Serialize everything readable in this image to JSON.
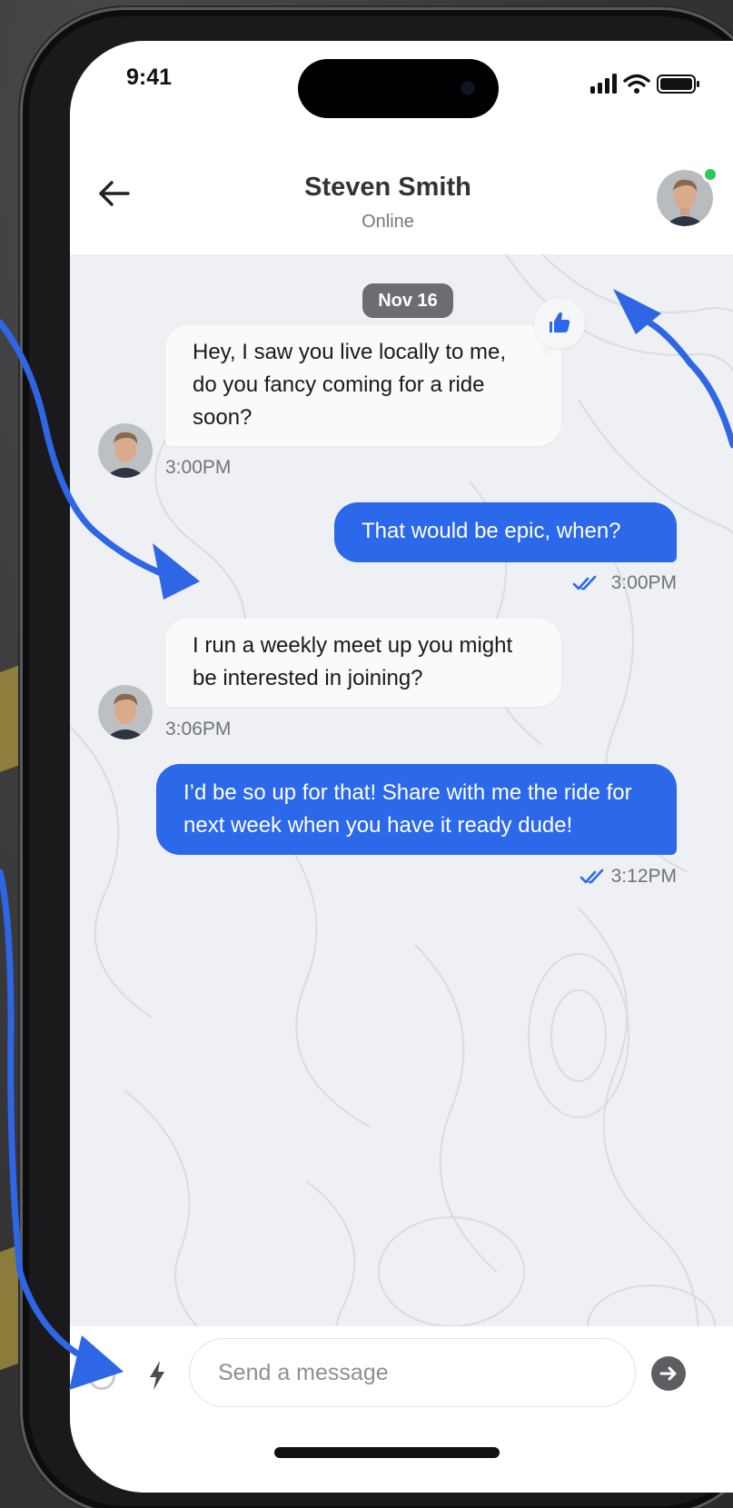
{
  "status_bar": {
    "time": "9:41"
  },
  "header": {
    "contact_name": "Steven Smith",
    "presence": "Online"
  },
  "chat": {
    "date_label": "Nov 16",
    "messages": [
      {
        "direction": "incoming",
        "text": "Hey, I saw you live locally to me, do you fancy coming for a ride soon?",
        "time": "3:00PM",
        "reaction": "thumbs-up-icon"
      },
      {
        "direction": "outgoing",
        "text": "That would be epic, when?",
        "time": "3:00PM",
        "status": "read"
      },
      {
        "direction": "incoming",
        "text": "I run a weekly meet up you might be interested in joining?",
        "time": "3:06PM"
      },
      {
        "direction": "outgoing",
        "text": "I’d be so up for that! Share with me the ride for next week when you have it ready dude!",
        "time": "3:12PM",
        "status": "read"
      }
    ]
  },
  "composer": {
    "placeholder": "Send a message"
  },
  "colors": {
    "outgoing_bubble": "#2b68ea",
    "incoming_bubble": "#fafafa",
    "online_dot": "#2ec95a",
    "annotation_arrow": "#2f66e6"
  }
}
